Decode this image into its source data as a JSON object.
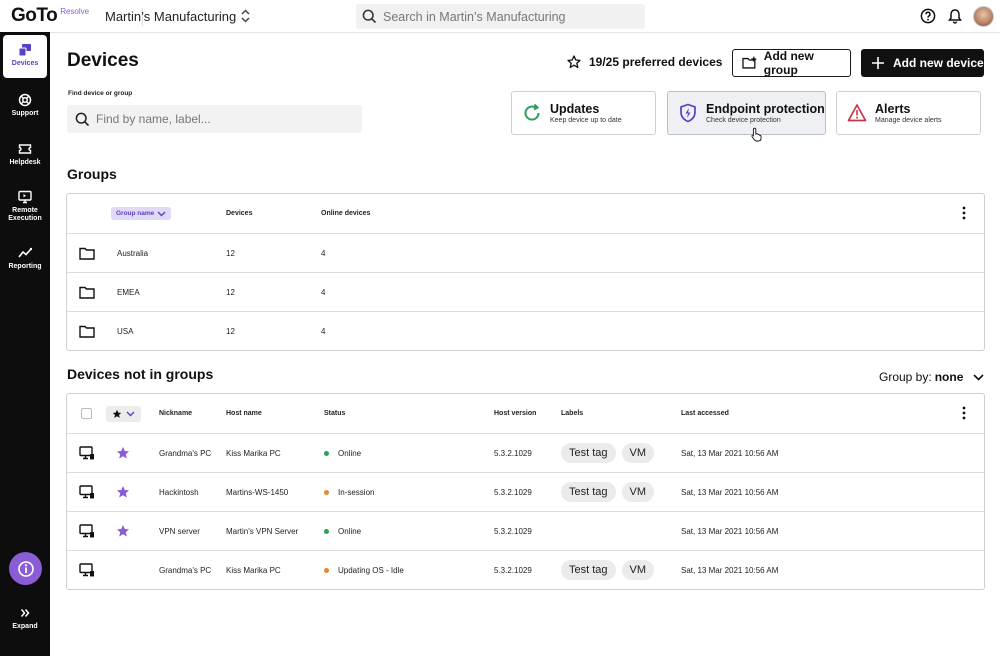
{
  "brand": {
    "logo": "GoTo",
    "product": "Resolve",
    "accent": "#8a5cd6"
  },
  "topbar": {
    "org_name": "Martin’s Manufacturing",
    "search_placeholder": "Search in Martin’s Manufacturing"
  },
  "sidebar": {
    "items": [
      {
        "label": "Devices",
        "icon": "devices-icon",
        "active": true
      },
      {
        "label": "Support",
        "icon": "lifebuoy-icon",
        "active": false
      },
      {
        "label": "Helpdesk",
        "icon": "ticket-icon",
        "active": false
      },
      {
        "label": "Remote",
        "label2": "Execution",
        "icon": "monitor-icon",
        "active": false
      },
      {
        "label": "Reporting",
        "icon": "chart-line-icon",
        "active": false
      }
    ],
    "expand_label": "Expand"
  },
  "main": {
    "title": "Devices",
    "preferred": "19/25 preferred devices",
    "add_group": "Add new group",
    "add_device": "Add new device",
    "find_label": "Find device or group",
    "find_placeholder": "Find by name, label...",
    "cards": [
      {
        "title": "Updates",
        "sub": "Keep device up to date",
        "icon": "refresh-icon"
      },
      {
        "title": "Endpoint protection",
        "sub": "Check device protection",
        "icon": "shield-icon"
      },
      {
        "title": "Alerts",
        "sub": "Manage device alerts",
        "icon": "warning-icon"
      }
    ]
  },
  "groups": {
    "title": "Groups",
    "headers": {
      "name": "Group name",
      "devices": "Devices",
      "online": "Online devices"
    },
    "rows": [
      {
        "name": "Australia",
        "devices": "12",
        "online": "4"
      },
      {
        "name": "EMEA",
        "devices": "12",
        "online": "4"
      },
      {
        "name": "USA",
        "devices": "12",
        "online": "4"
      }
    ]
  },
  "devices": {
    "title": "Devices not in groups",
    "group_by_label": "Group by:",
    "group_by_value": "none",
    "headers": {
      "nickname": "Nickname",
      "host": "Host name",
      "status": "Status",
      "version": "Host version",
      "labels": "Labels",
      "accessed": "Last accessed"
    },
    "rows": [
      {
        "starred": true,
        "nickname": "Grandma's PC",
        "host": "Kiss Marika PC",
        "status": "Online",
        "status_color": "#2e9e5b",
        "version": "5.3.2.1029",
        "labels": [
          "Test tag",
          "VM"
        ],
        "accessed": "Sat, 13 Mar 2021 10:56 AM"
      },
      {
        "starred": true,
        "nickname": "Hackintosh",
        "host": "Martins-WS-1450",
        "status": "In-session",
        "status_color": "#e08a2c",
        "version": "5.3.2.1029",
        "labels": [
          "Test tag",
          "VM"
        ],
        "accessed": "Sat, 13 Mar 2021 10:56 AM"
      },
      {
        "starred": true,
        "nickname": "VPN server",
        "host": "Martin's VPN Server",
        "status": "Online",
        "status_color": "#2e9e5b",
        "version": "5.3.2.1029",
        "labels": [],
        "accessed": "Sat, 13 Mar 2021 10:56 AM"
      },
      {
        "starred": false,
        "nickname": "Grandma's PC",
        "host": "Kiss Marika PC",
        "status": "Updating OS - Idle",
        "status_color": "#e08a2c",
        "version": "5.3.2.1029",
        "labels": [
          "Test tag",
          "VM"
        ],
        "accessed": "Sat, 13 Mar 2021 10:56 AM"
      }
    ]
  }
}
